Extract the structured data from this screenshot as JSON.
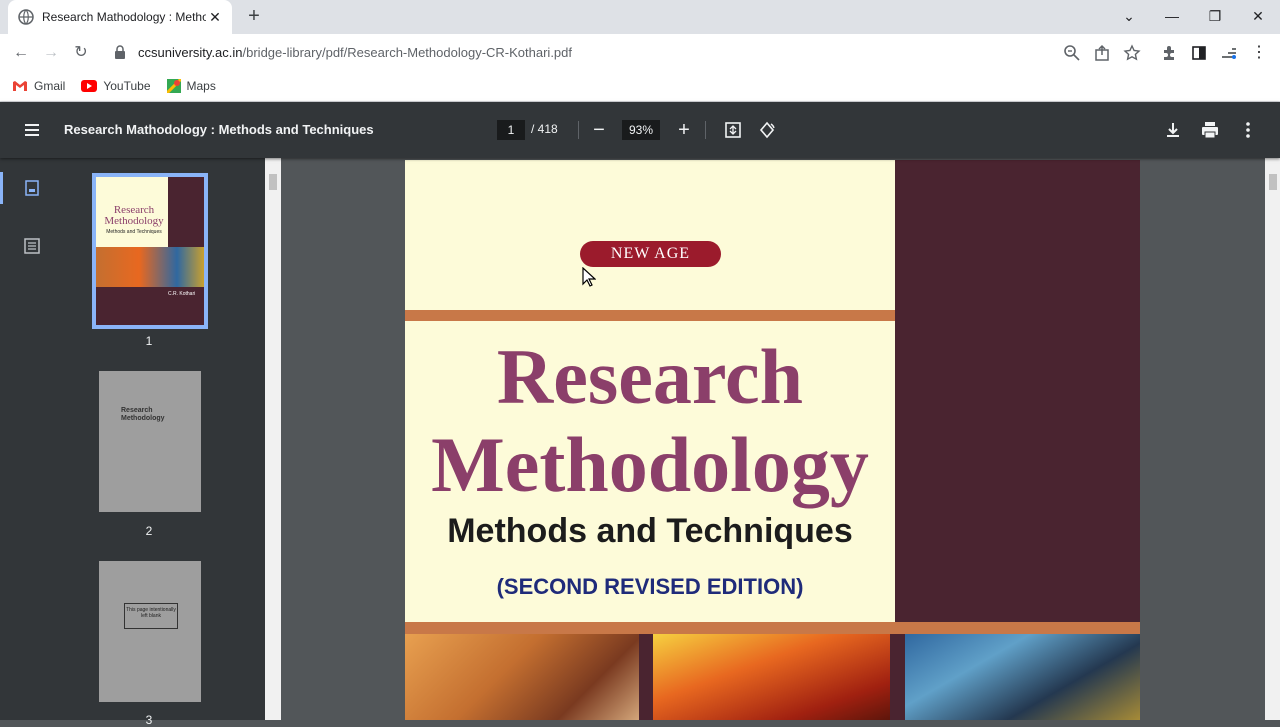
{
  "browser": {
    "tab_title": "Research Mathodology : Methods and Techniques",
    "url_host": "ccsuniversity.ac.in",
    "url_path": "/bridge-library/pdf/Research-Methodology-CR-Kothari.pdf",
    "bookmarks": [
      {
        "label": "Gmail",
        "icon": "gmail-icon"
      },
      {
        "label": "YouTube",
        "icon": "youtube-icon"
      },
      {
        "label": "Maps",
        "icon": "maps-icon"
      }
    ]
  },
  "pdf_viewer": {
    "title": "Research Mathodology : Methods and Techniques",
    "current_page": "1",
    "total_pages": "/ 418",
    "zoom": "93%",
    "thumbnails": [
      {
        "label": "1",
        "selected": true
      },
      {
        "label": "2",
        "selected": false
      },
      {
        "label": "3",
        "selected": false
      }
    ],
    "thumb2_text": "Research Methodology",
    "thumb3_text": "This page intentionally left blank"
  },
  "cover": {
    "publisher": "NEW AGE",
    "title_line1": "Research",
    "title_line2": "Methodology",
    "subtitle": "Methods and Techniques",
    "edition": "(SECOND REVISED EDITION)",
    "colors": {
      "cream": "#fdfbd9",
      "maroon": "#4a2430",
      "title_purple": "#8b3f6a",
      "edition_blue": "#1f2b7a"
    }
  },
  "thumb1": {
    "line1": "Research",
    "line2": "Methodology",
    "line3": "Methods and Techniques",
    "author": "C.R. Kothari"
  }
}
